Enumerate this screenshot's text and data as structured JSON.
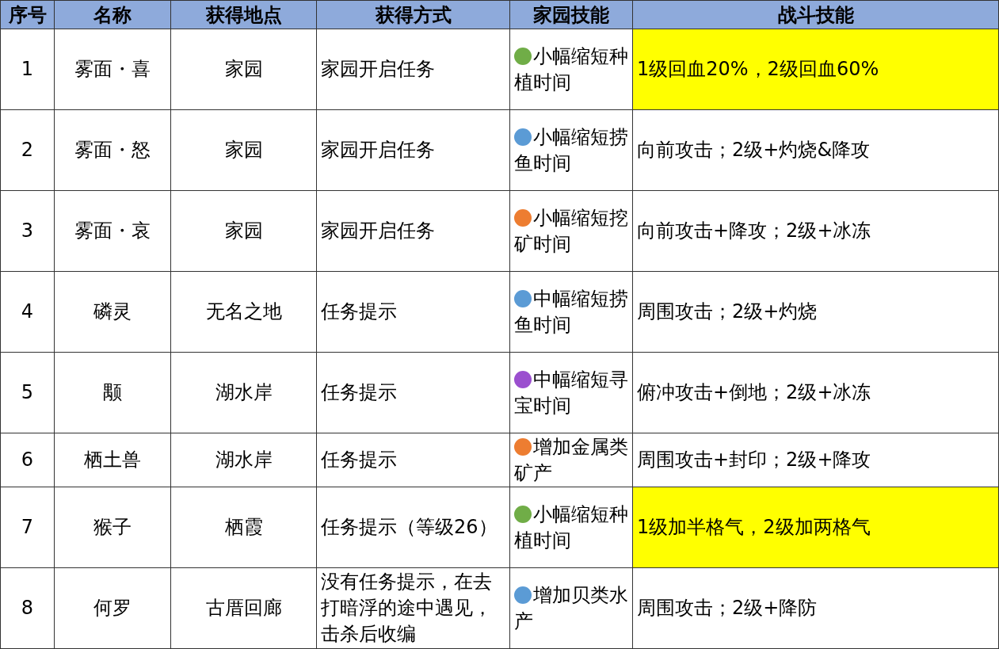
{
  "table": {
    "columns": [
      "序号",
      "名称",
      "获得地点",
      "获得方式",
      "家园技能",
      "战斗技能"
    ],
    "rows": [
      {
        "index": "1",
        "name": "雾面・喜",
        "location": "家园",
        "method": "家园开启任务",
        "home_skill": {
          "color": "#70ad47",
          "text": "小幅缩短种植时间"
        },
        "battle_skill": {
          "text": "1级回血20%，2级回血60%",
          "highlighted": true
        }
      },
      {
        "index": "2",
        "name": "雾面・怒",
        "location": "家园",
        "method": "家园开启任务",
        "home_skill": {
          "color": "#5b9bd5",
          "text": "小幅缩短捞鱼时间"
        },
        "battle_skill": {
          "text": "向前攻击；2级+灼烧&降攻",
          "highlighted": false
        }
      },
      {
        "index": "3",
        "name": "雾面・哀",
        "location": "家园",
        "method": "家园开启任务",
        "home_skill": {
          "color": "#ed7d31",
          "text": "小幅缩短挖矿时间"
        },
        "battle_skill": {
          "text": "向前攻击+降攻；2级+冰冻",
          "highlighted": false
        }
      },
      {
        "index": "4",
        "name": "磷灵",
        "location": "无名之地",
        "method": "任务提示",
        "home_skill": {
          "color": "#5b9bd5",
          "text": "中幅缩短捞鱼时间"
        },
        "battle_skill": {
          "text": "周围攻击；2级+灼烧",
          "highlighted": false
        }
      },
      {
        "index": "5",
        "name": "颙",
        "location": "湖水岸",
        "method": "任务提示",
        "home_skill": {
          "color": "#9b4fcf",
          "text": "中幅缩短寻宝时间"
        },
        "battle_skill": {
          "text": "俯冲攻击+倒地；2级+冰冻",
          "highlighted": false
        }
      },
      {
        "index": "6",
        "name": "栖土兽",
        "location": "湖水岸",
        "method": "任务提示",
        "home_skill": {
          "color": "#ed7d31",
          "text": "增加金属类矿产"
        },
        "battle_skill": {
          "text": "周围攻击+封印；2级+降攻",
          "highlighted": false
        }
      },
      {
        "index": "7",
        "name": "猴子",
        "location": "栖霞",
        "method": "任务提示（等级26）",
        "home_skill": {
          "color": "#70ad47",
          "text": "小幅缩短种植时间"
        },
        "battle_skill": {
          "text": "1级加半格气，2级加两格气",
          "highlighted": true
        }
      },
      {
        "index": "8",
        "name": "何罗",
        "location": "古厝回廊",
        "method": "没有任务提示，在去打暗浮的途中遇见，击杀后收编",
        "home_skill": {
          "color": "#5b9bd5",
          "text": "增加贝类水产"
        },
        "battle_skill": {
          "text": "周围攻击；2级+降防",
          "highlighted": false
        }
      }
    ]
  }
}
